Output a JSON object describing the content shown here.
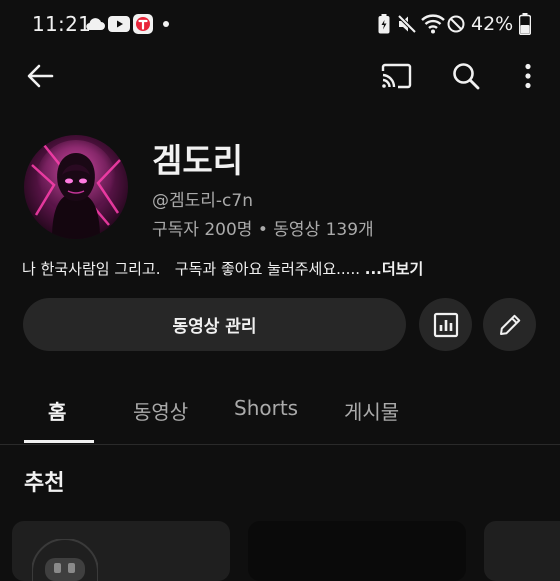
{
  "status_bar": {
    "time": "11:21",
    "battery": "42%",
    "left_icons": [
      "cloud-icon",
      "youtube-icon",
      "app-t-icon",
      "dot-icon"
    ],
    "right_icons": [
      "battery-saver-icon",
      "mute-icon",
      "wifi-icon",
      "do-not-disturb-icon",
      "battery-icon"
    ]
  },
  "app_bar": {
    "icons": [
      "back-arrow-icon",
      "cast-icon",
      "search-icon",
      "more-vert-icon"
    ]
  },
  "channel": {
    "name": "겜도리",
    "handle": "@겜도리-c7n",
    "stats": "구독자 200명 • 동영상 139개",
    "description": "나 한국사람임 그리고.   구독과 좋아요 눌러주세요..... ",
    "more_label": "...더보기"
  },
  "actions": {
    "manage_videos_label": "동영상 관리",
    "analytics_icon": "analytics-icon",
    "edit_icon": "edit-pencil-icon"
  },
  "tabs": [
    {
      "label": "홈",
      "active": true
    },
    {
      "label": "동영상",
      "active": false
    },
    {
      "label": "Shorts",
      "active": false
    },
    {
      "label": "게시물",
      "active": false
    }
  ],
  "section": {
    "title": "추천"
  },
  "colors": {
    "background": "#0f0f0f",
    "surface": "#272727",
    "text_primary": "#f1f1f1",
    "text_secondary": "#aaaaaa",
    "youtube_red": "#ff0000",
    "avatar_accent": "#ff3fae"
  }
}
